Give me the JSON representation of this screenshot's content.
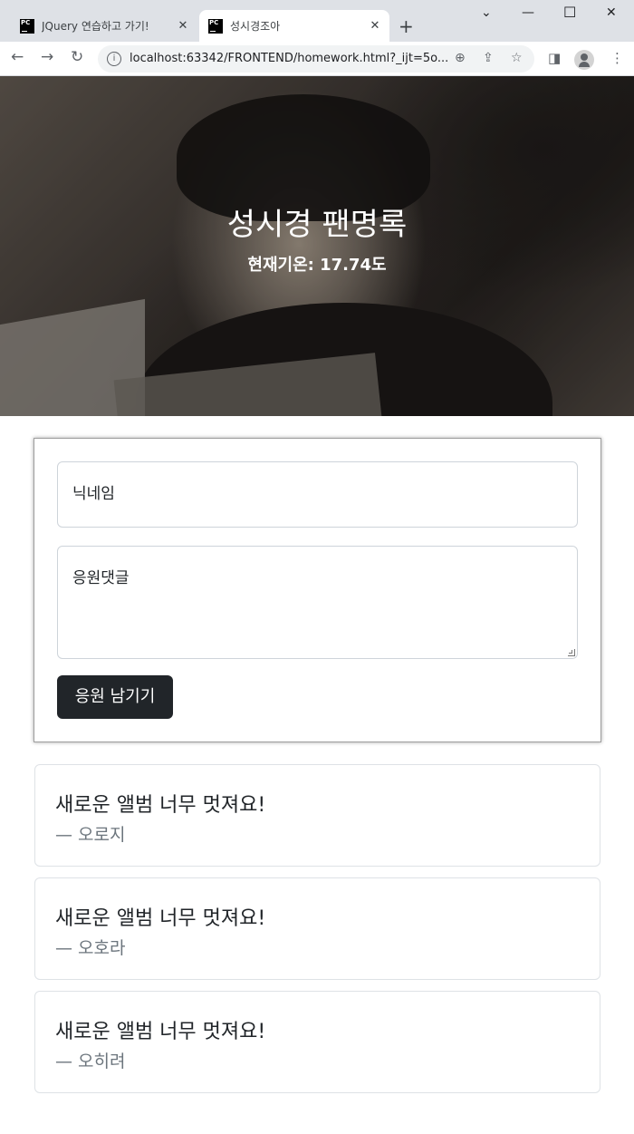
{
  "browser": {
    "tabs": [
      {
        "title": "JQuery 연습하고 가기!",
        "active": false
      },
      {
        "title": "성시경조아",
        "active": true
      }
    ],
    "url": "localhost:63342/FRONTEND/homework.html?_ijt=5o..."
  },
  "hero": {
    "title": "성시경 팬명록",
    "temperature": "현재기온: 17.74도"
  },
  "form": {
    "nickname_placeholder": "닉네임",
    "comment_placeholder": "응원댓글",
    "submit_label": "응원 남기기"
  },
  "comments": [
    {
      "message": "새로운 앨범 너무 멋져요!",
      "author": "— 오로지"
    },
    {
      "message": "새로운 앨범 너무 멋져요!",
      "author": "— 오호라"
    },
    {
      "message": "새로운 앨범 너무 멋져요!",
      "author": "— 오히려"
    }
  ],
  "icons": {
    "back": "arrow-left-icon",
    "forward": "arrow-right-icon",
    "reload": "reload-icon",
    "info": "info-icon",
    "zoom": "zoom-icon",
    "share": "share-icon",
    "bookmark": "star-icon",
    "sidepanel": "side-panel-icon",
    "profile": "profile-icon",
    "menu": "kebab-menu-icon"
  }
}
